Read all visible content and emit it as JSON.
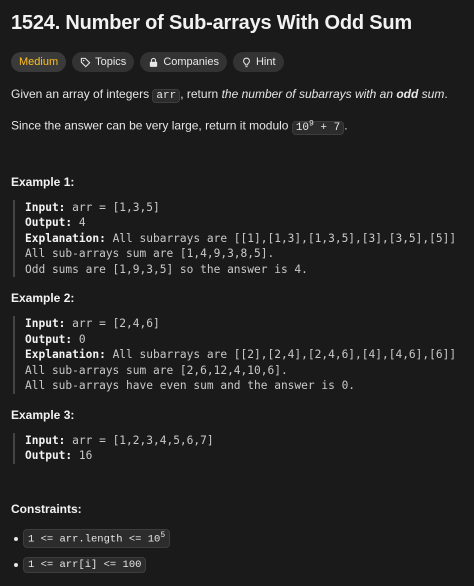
{
  "problem": {
    "title": "1524. Number of Sub-arrays With Odd Sum",
    "tags": {
      "difficulty": "Medium",
      "topics": "Topics",
      "companies": "Companies",
      "hint": "Hint"
    },
    "description": {
      "p1_a": "Given an array of integers ",
      "p1_code": "arr",
      "p1_b": ", return ",
      "p1_em1": "the number of subarrays with an ",
      "p1_strong": "odd",
      "p1_em2": " sum",
      "p1_c": ".",
      "p2_a": "Since the answer can be very large, return it modulo ",
      "p2_code_base": "10",
      "p2_code_exp": "9",
      "p2_code_rest": " + 7",
      "p2_b": "."
    }
  },
  "examples": [
    {
      "title": "Example 1:",
      "input_label": "Input:",
      "input": " arr = [1,3,5]",
      "output_label": "Output:",
      "output": " 4",
      "explanation_label": "Explanation:",
      "explanation": " All subarrays are [[1],[1,3],[1,3,5],[3],[3,5],[5]]",
      "explanation_lines": [
        "All sub-arrays sum are [1,4,9,3,8,5].",
        "Odd sums are [1,9,3,5] so the answer is 4."
      ]
    },
    {
      "title": "Example 2:",
      "input_label": "Input:",
      "input": " arr = [2,4,6]",
      "output_label": "Output:",
      "output": " 0",
      "explanation_label": "Explanation:",
      "explanation": " All subarrays are [[2],[2,4],[2,4,6],[4],[4,6],[6]]",
      "explanation_lines": [
        "All sub-arrays sum are [2,6,12,4,10,6].",
        "All sub-arrays have even sum and the answer is 0."
      ]
    },
    {
      "title": "Example 3:",
      "input_label": "Input:",
      "input": " arr = [1,2,3,4,5,6,7]",
      "output_label": "Output:",
      "output": " 16"
    }
  ],
  "constraints": {
    "title": "Constraints:",
    "items": [
      {
        "a": "1 <= arr.length <= 10",
        "exp": "5"
      },
      {
        "a": "1 <= arr[i] <= 100",
        "exp": ""
      }
    ]
  },
  "colors": {
    "background": "#1a1a1a",
    "difficulty_medium": "#ffc01e",
    "tag_bg": "#333333"
  },
  "icons": [
    "tag-icon",
    "lock-icon",
    "lightbulb-icon"
  ]
}
